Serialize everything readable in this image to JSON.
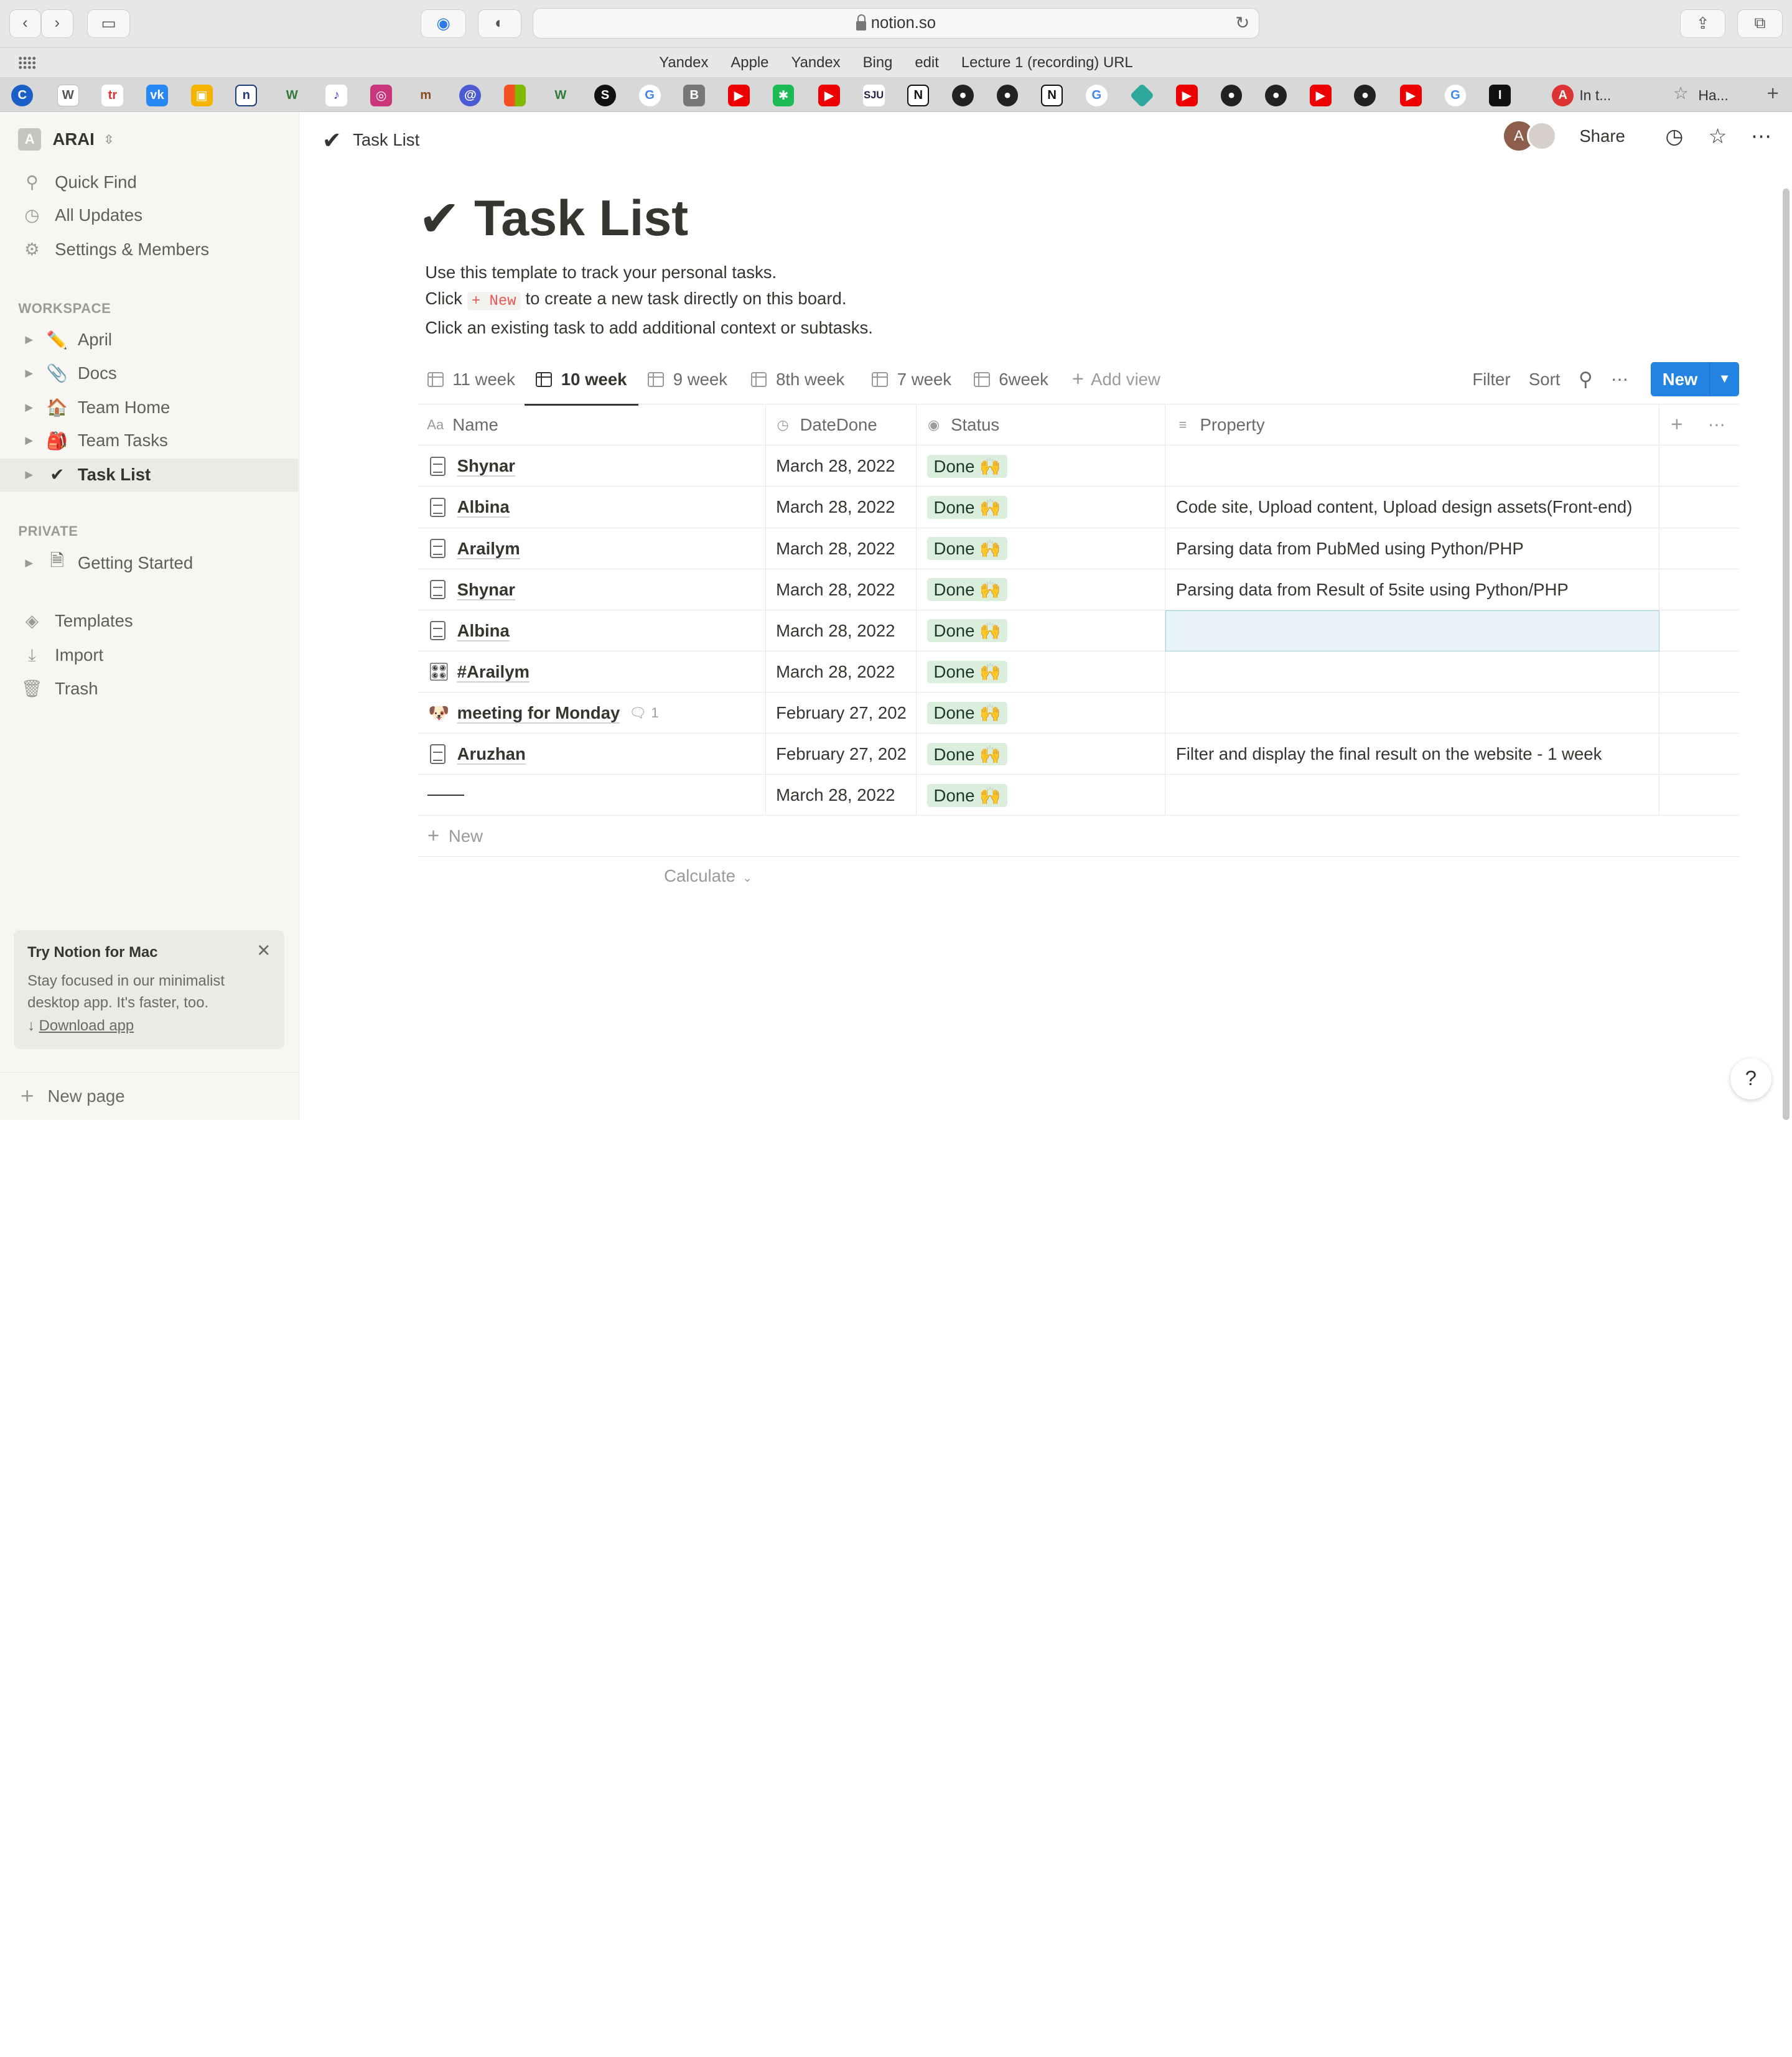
{
  "browser": {
    "url": "notion.so",
    "favorites": [
      "Yandex",
      "Apple",
      "Yandex",
      "Bing",
      "edit",
      "Lecture 1 (recording) URL"
    ],
    "tabs": [
      {
        "label": "In t..."
      },
      {
        "label": "Ha..."
      }
    ]
  },
  "sidebar": {
    "workspace_initial": "A",
    "workspace_name": "ARAI",
    "top_items": [
      {
        "label": "Quick Find",
        "icon": "search-icon"
      },
      {
        "label": "All Updates",
        "icon": "clock-icon"
      },
      {
        "label": "Settings & Members",
        "icon": "gear-icon"
      }
    ],
    "workspace_label": "WORKSPACE",
    "workspace_items": [
      {
        "label": "April",
        "emoji": "✏️"
      },
      {
        "label": "Docs",
        "emoji": "📎"
      },
      {
        "label": "Team Home",
        "emoji": "🏠"
      },
      {
        "label": "Team Tasks",
        "emoji": "🎒"
      },
      {
        "label": "Task List",
        "emoji": "✔"
      }
    ],
    "private_label": "PRIVATE",
    "private_items": [
      {
        "label": "Getting Started"
      }
    ],
    "bottom_items": [
      {
        "label": "Templates",
        "icon": "templates-icon"
      },
      {
        "label": "Import",
        "icon": "import-icon"
      },
      {
        "label": "Trash",
        "icon": "trash-icon"
      }
    ],
    "promo": {
      "title": "Try Notion for Mac",
      "desc": "Stay focused in our minimalist desktop app. It's faster, too.",
      "link": "Download app"
    },
    "new_page": "New page"
  },
  "topbar": {
    "crumb": "Task List",
    "avatar_initial": "A",
    "share": "Share"
  },
  "page": {
    "title": "Task List",
    "desc_line1": "Use this template to track your personal tasks.",
    "desc_line2_pre": "Click",
    "desc_line2_code": "+ New",
    "desc_line2_post": "to create a new task directly on this board.",
    "desc_line3": "Click an existing task to add additional context or subtasks."
  },
  "views": {
    "tabs": [
      "11 week",
      "10 week",
      "9 week",
      "8th week",
      "7 week",
      "6week"
    ],
    "active": "10 week",
    "add_view": "Add view",
    "filter": "Filter",
    "sort": "Sort",
    "new": "New"
  },
  "table": {
    "headers": {
      "name": "Name",
      "date": "DateDone",
      "status": "Status",
      "property": "Property"
    },
    "rows": [
      {
        "name": "Shynar",
        "date": "March 28, 2022",
        "status": "Done 🙌",
        "property": ""
      },
      {
        "name": "Albina",
        "date": "March 28, 2022",
        "status": "Done 🙌",
        "property": "Code site, Upload content, Upload design assets(Front-end)"
      },
      {
        "name": "Arailym",
        "date": "March 28, 2022",
        "status": "Done 🙌",
        "property": "Parsing data from PubMed using Python/PHP"
      },
      {
        "name": "Shynar",
        "date": "March 28, 2022",
        "status": "Done 🙌",
        "property": "Parsing data from Result of 5site using Python/PHP"
      },
      {
        "name": "Albina",
        "date": "March 28, 2022",
        "status": "Done 🙌",
        "property": ""
      },
      {
        "name": "#Arailym",
        "date": "March 28, 2022",
        "status": "Done 🙌",
        "property": ""
      },
      {
        "name": "meeting for Monday",
        "date": "February 27, 202",
        "status": "Done 🙌",
        "property": "",
        "comments": "1"
      },
      {
        "name": "Aruzhan",
        "date": "February 27, 202",
        "status": "Done 🙌",
        "property": "Filter and display the final result on the website - 1 week"
      },
      {
        "name": "",
        "date": "March 28, 2022",
        "status": "Done 🙌",
        "property": ""
      }
    ],
    "new_row": "New",
    "calculate": "Calculate"
  },
  "help": "?"
}
